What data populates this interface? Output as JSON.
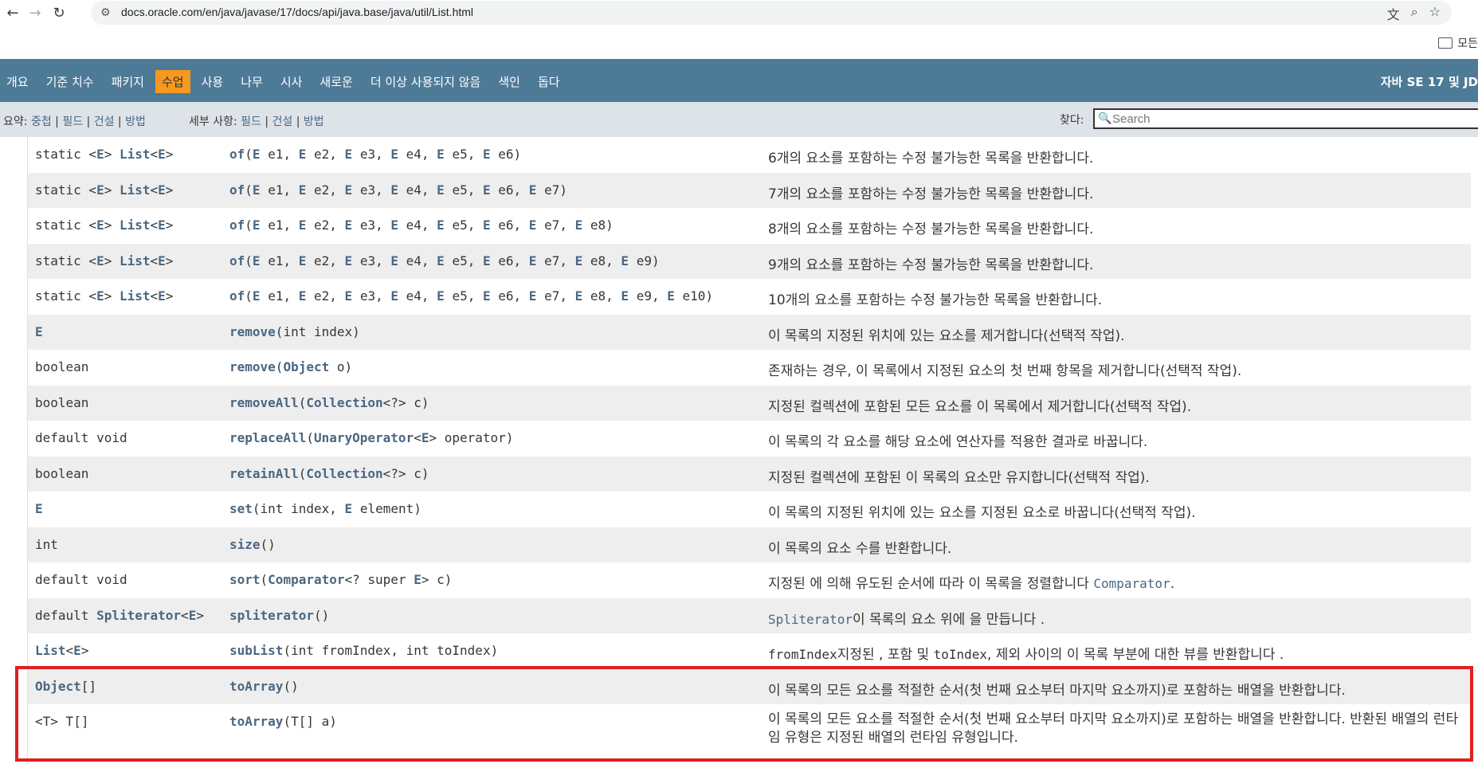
{
  "browser": {
    "url": "docs.oracle.com/en/java/javase/17/docs/api/java.base/java/util/List.html",
    "bookmark_folder": "모든"
  },
  "topnav": {
    "items": [
      "개요",
      "기준 치수",
      "패키지",
      "수업",
      "사용",
      "나무",
      "시사",
      "새로운",
      "더 이상 사용되지 않음",
      "색인",
      "돕다"
    ],
    "active_index": 3,
    "right_title": "자바 SE 17 및 JD"
  },
  "subnav": {
    "summary_label": "요약:",
    "summary_links": [
      "중첩",
      "필드",
      "건설",
      "방법"
    ],
    "detail_label": "세부 사항:",
    "detail_links": [
      "필드",
      "건설",
      "방법"
    ],
    "search_label": "찾다:",
    "search_placeholder": "Search"
  },
  "colors": {
    "nav_bg": "#4d7a97",
    "nav_active": "#f8981d",
    "subnav_bg": "#dee3e9",
    "link": "#4a6782",
    "highlight": "#e0201f"
  },
  "rows": [
    {
      "mod": "static <E> List<E>",
      "name": "of",
      "params": "(E e1, E e2, E e3, E e4, E e5, E e6)",
      "desc": "6개의 요소를 포함하는 수정 불가능한 목록을 반환합니다."
    },
    {
      "mod": "static <E> List<E>",
      "name": "of",
      "params": "(E e1, E e2, E e3, E e4, E e5, E e6, E e7)",
      "desc": "7개의 요소를 포함하는 수정 불가능한 목록을 반환합니다."
    },
    {
      "mod": "static <E> List<E>",
      "name": "of",
      "params": "(E e1, E e2, E e3, E e4, E e5, E e6, E e7, E e8)",
      "desc": "8개의 요소를 포함하는 수정 불가능한 목록을 반환합니다."
    },
    {
      "mod": "static <E> List<E>",
      "name": "of",
      "params": "(E e1, E e2, E e3, E e4, E e5, E e6, E e7, E e8, E e9)",
      "desc": "9개의 요소를 포함하는 수정 불가능한 목록을 반환합니다."
    },
    {
      "mod": "static <E> List<E>",
      "name": "of",
      "params": "(E e1, E e2, E e3, E e4, E e5, E e6, E e7, E e8, E e9, E e10)",
      "desc": "10개의 요소를 포함하는 수정 불가능한 목록을 반환합니다."
    },
    {
      "mod": "E",
      "name": "remove",
      "params": "(int index)",
      "desc": "이 목록의 지정된 위치에 있는 요소를 제거합니다(선택적 작업)."
    },
    {
      "mod": "boolean",
      "name": "remove",
      "params": "(Object o)",
      "desc": "존재하는 경우, 이 목록에서 지정된 요소의 첫 번째 항목을 제거합니다(선택적 작업)."
    },
    {
      "mod": "boolean",
      "name": "removeAll",
      "params": "(Collection<?> c)",
      "desc": "지정된 컬렉션에 포함된 모든 요소를 이 목록에서 제거합니다(선택적 작업)."
    },
    {
      "mod": "default void",
      "name": "replaceAll",
      "params": "(UnaryOperator<E> operator)",
      "desc": "이 목록의 각 요소를 해당 요소에 연산자를 적용한 결과로 바꿉니다."
    },
    {
      "mod": "boolean",
      "name": "retainAll",
      "params": "(Collection<?> c)",
      "desc": "지정된 컬렉션에 포함된 이 목록의 요소만 유지합니다(선택적 작업)."
    },
    {
      "mod": "E",
      "name": "set",
      "params": "(int index, E element)",
      "desc": "이 목록의 지정된 위치에 있는 요소를 지정된 요소로 바꿉니다(선택적 작업)."
    },
    {
      "mod": "int",
      "name": "size",
      "params": "()",
      "desc": "이 목록의 요소 수를 반환합니다."
    },
    {
      "mod": "default void",
      "name": "sort",
      "params": "(Comparator<? super E> c)",
      "desc_pre": "지정된 에 의해 유도된 순서에 따라 이 목록을 정렬합니다 ",
      "desc_code": "Comparator",
      "desc_post": "."
    },
    {
      "mod": "default Spliterator<E>",
      "name": "spliterator",
      "params": "()",
      "desc_code": "Spliterator",
      "desc_post": "이 목록의 요소 위에 을 만듭니다 ."
    },
    {
      "mod": "List<E>",
      "name": "subList",
      "params": "(int fromIndex, int toIndex)",
      "desc_code1": "fromIndex",
      "desc_mid1": "지정된 , 포함 및 ",
      "desc_code2": "toIndex",
      "desc_post": ", 제외 사이의 이 목록 부분에 대한 뷰를 반환합니다 ."
    },
    {
      "mod": "Object[]",
      "name": "toArray",
      "params": "()",
      "desc": "이 목록의 모든 요소를 적절한 순서(첫 번째 요소부터 마지막 요소까지)로 포함하는 배열을 반환합니다."
    },
    {
      "mod": "<T> T[]",
      "name": "toArray",
      "params": "(T[] a)",
      "desc": "이 목록의 모든 요소를 적절한 순서(첫 번째 요소부터 마지막 요소까지)로 포함하는 배열을 반환합니다. 반환된 배열의 런타임 유형은 지정된 배열의 런타임 유형입니다."
    }
  ]
}
